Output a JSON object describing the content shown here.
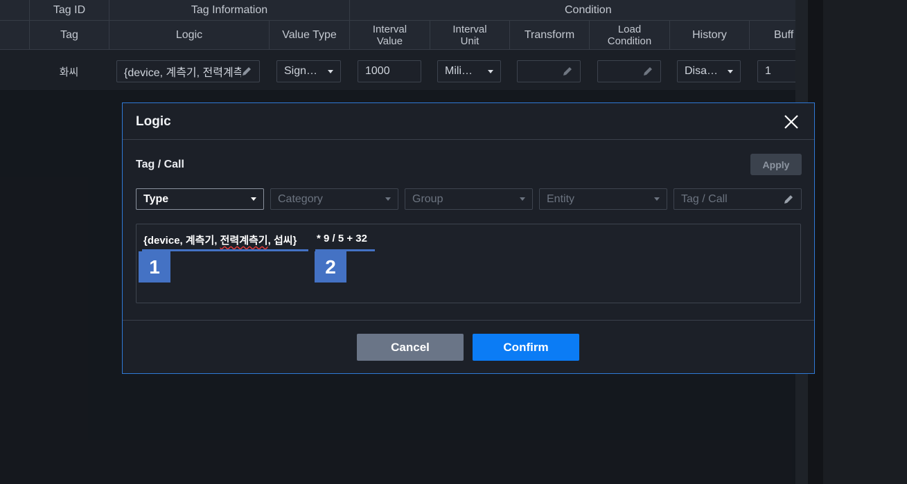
{
  "header": {
    "group_row": {
      "tag_id": "Tag ID",
      "tag_information": "Tag Information",
      "condition": "Condition"
    },
    "columns": {
      "tag": "Tag",
      "logic": "Logic",
      "value_type": "Value Type",
      "interval_value": "Interval Value",
      "interval_unit": "Interval Unit",
      "transform": "Transform",
      "load_condition": "Load Condition",
      "history": "History",
      "buffer": "Buff"
    }
  },
  "row": {
    "tag": "화씨",
    "logic": "{device, 계측기, 전력계측기, 섭씨}",
    "value_type": "Sign…",
    "interval_value": "1000",
    "interval_unit": "Mili…",
    "transform": "",
    "load_condition": "",
    "history": "Disa…",
    "buffer": "1"
  },
  "modal": {
    "title": "Logic",
    "section_title": "Tag / Call",
    "apply_label": "Apply",
    "selectors": {
      "type": "Type",
      "category": "Category",
      "group": "Group",
      "entity": "Entity",
      "tag_call_placeholder": "Tag / Call"
    },
    "expression": {
      "part1_prefix": "{device, 계측기, ",
      "part1_flagged": "전력계측기",
      "part1_suffix": ", 섭씨}",
      "part2": "* 9 / 5 + 32"
    },
    "annotations": [
      "1",
      "2"
    ],
    "cancel_label": "Cancel",
    "confirm_label": "Confirm"
  },
  "colors": {
    "accent": "#0b7cf5",
    "modal_border": "#2f7ad8",
    "annotation": "#4472c4",
    "cancel": "#6a7587"
  },
  "icons": [
    "pencil-icon",
    "chevron-down-icon",
    "close-icon"
  ]
}
